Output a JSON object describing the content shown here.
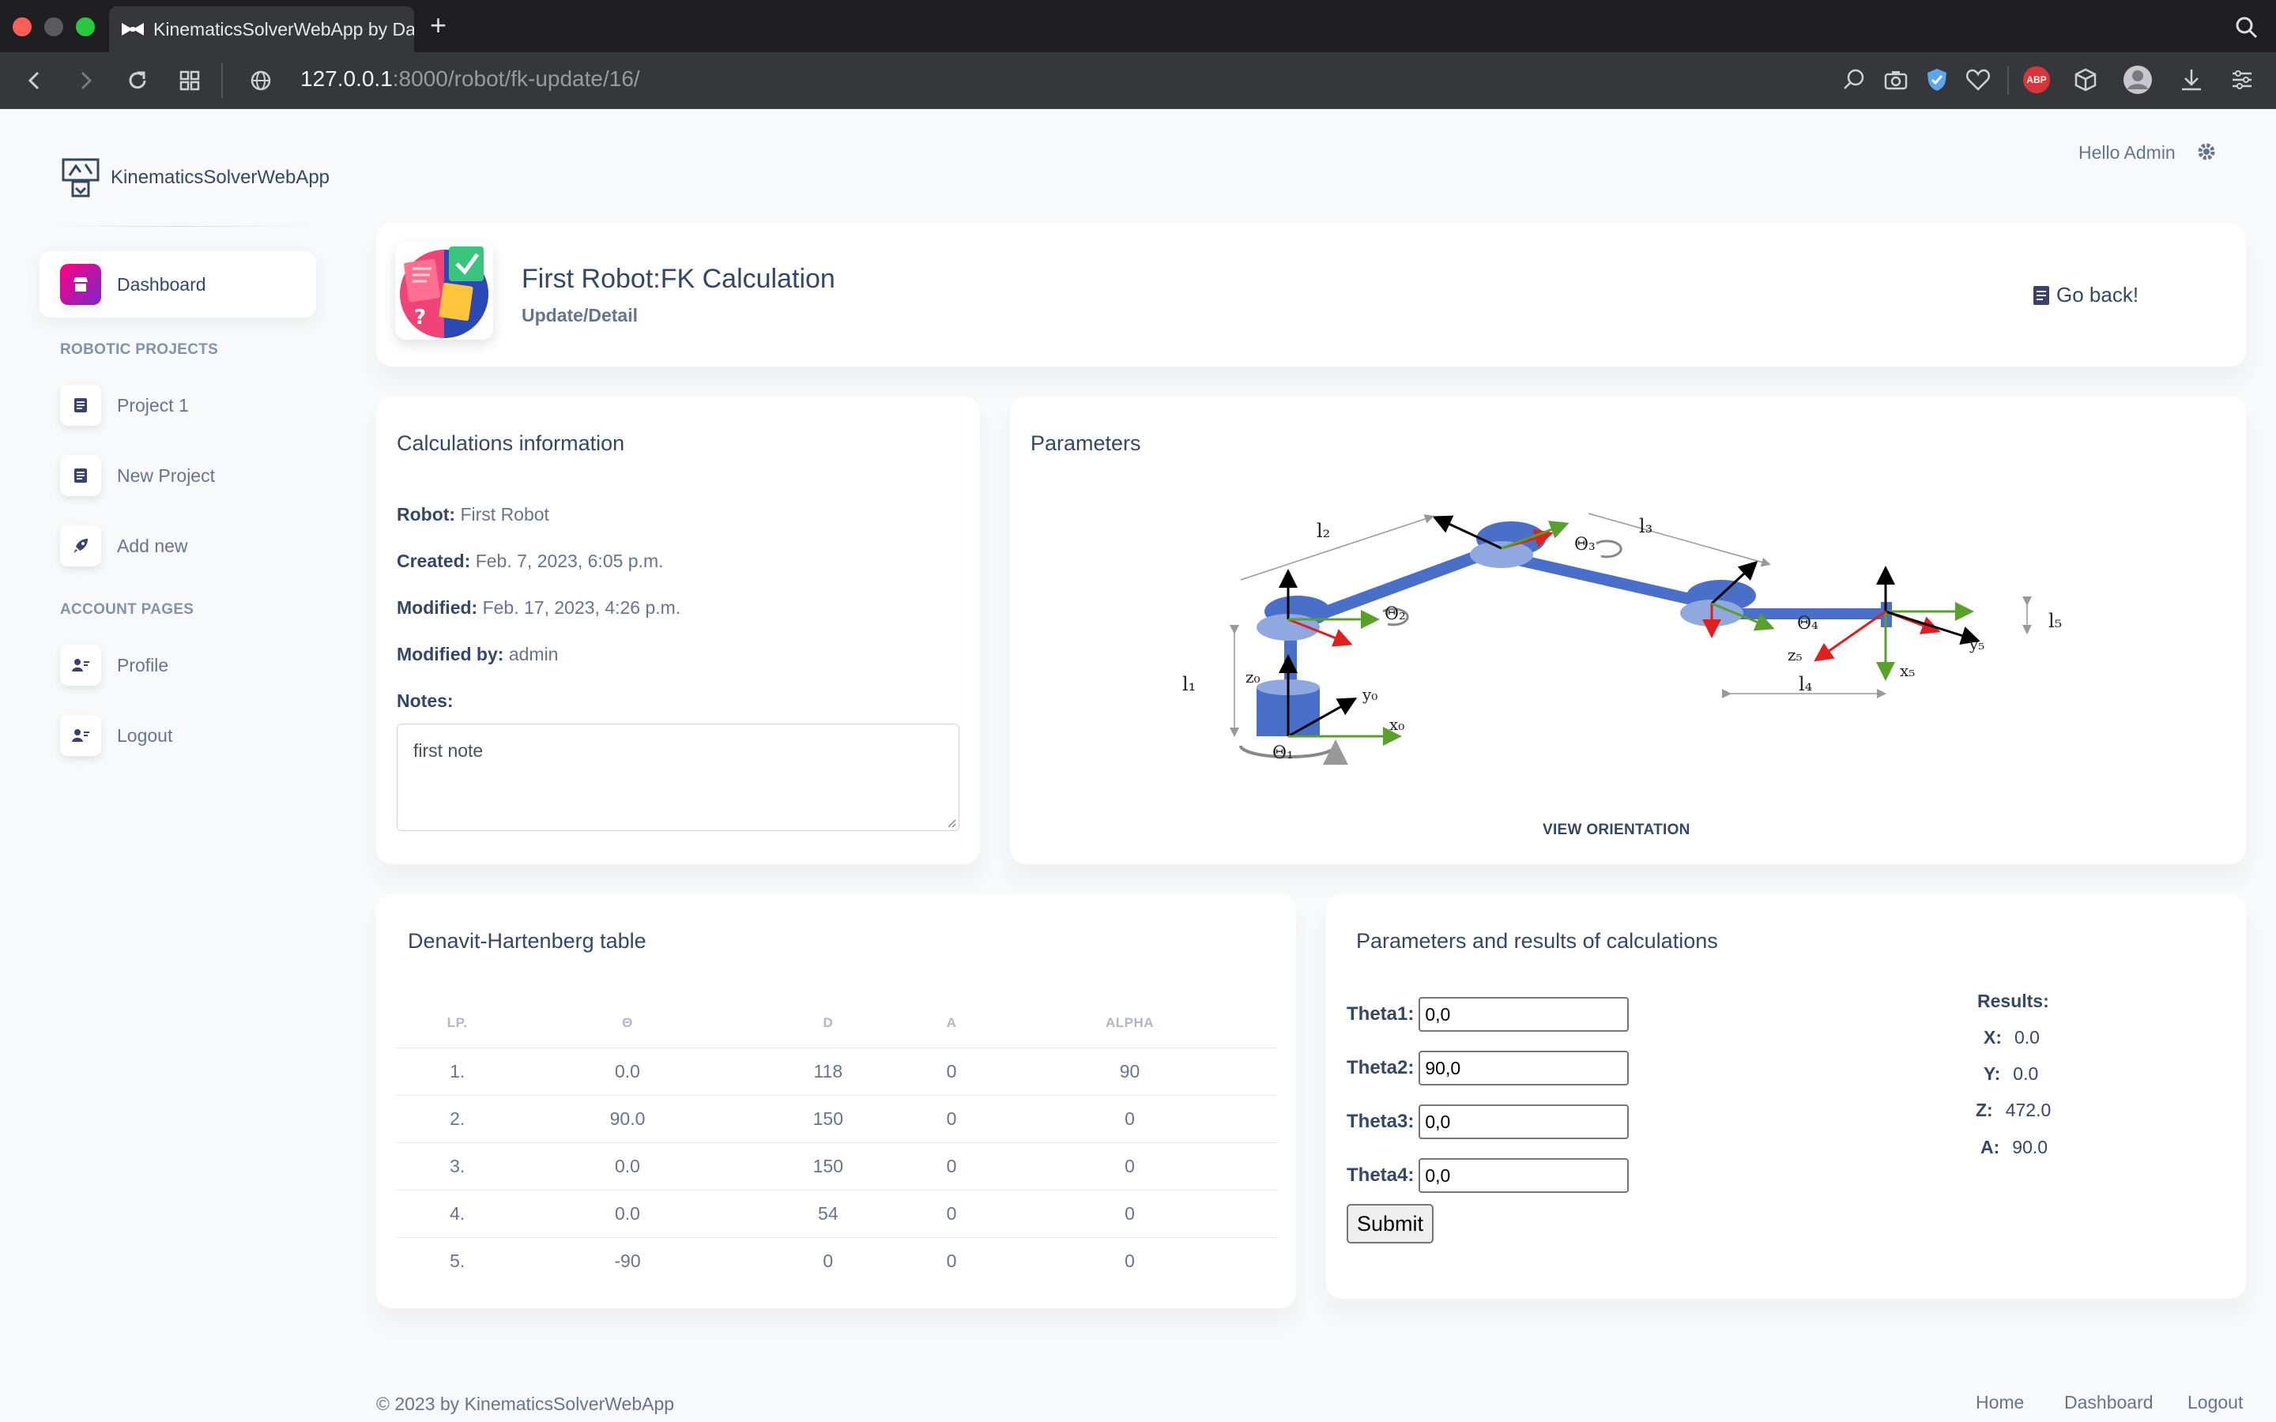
{
  "browser": {
    "tab_title": "KinematicsSolverWebApp by Da",
    "url_host": "127.0.0.1",
    "url_path": ":8000/robot/fk-update/16/",
    "colors": {
      "titlebar": "#1e1e21",
      "toolbar": "#36373b",
      "close": "#fe5f57",
      "minimize": "#febc2e",
      "maximize": "#28c840"
    },
    "icons": [
      "back-icon",
      "forward-icon",
      "reload-icon",
      "tabs-grid-icon",
      "globe-icon",
      "search-icon",
      "camera-icon",
      "shield-icon",
      "heart-icon",
      "adblock-icon",
      "box-icon",
      "profile-icon",
      "download-icon",
      "menu-icon"
    ],
    "adblock_label": "ABP"
  },
  "app": {
    "brand": "KinematicsSolverWebApp",
    "greeting": "Hello Admin",
    "accent": "#cb0c9f"
  },
  "sidebar": {
    "dashboard": "Dashboard",
    "section_projects": "ROBOTIC PROJECTS",
    "project1": "Project 1",
    "new_project": "New Project",
    "add_new": "Add new",
    "section_account": "ACCOUNT PAGES",
    "profile": "Profile",
    "logout": "Logout"
  },
  "header": {
    "title": "First Robot:FK Calculation",
    "subtitle": "Update/Detail",
    "go_back": "Go back!"
  },
  "calc_info": {
    "title": "Calculations information",
    "robot_label": "Robot:",
    "robot_value": "First Robot",
    "created_label": "Created:",
    "created_value": "Feb. 7, 2023, 6:05 p.m.",
    "modified_label": "Modified:",
    "modified_value": "Feb. 17, 2023, 4:26 p.m.",
    "modified_by_label": "Modified by:",
    "modified_by_value": "admin",
    "notes_label": "Notes:",
    "notes_value": "first note"
  },
  "parameters": {
    "title": "Parameters",
    "view_orientation": "VIEW ORIENTATION",
    "diagram_labels": {
      "l1": "l₁",
      "l2": "l₂",
      "l3": "l₃",
      "l4": "l₄",
      "l5": "l₅",
      "theta1": "Θ₁",
      "theta2": "Θ₂",
      "theta3": "Θ₃",
      "theta4": "Θ₄",
      "z0": "z₀",
      "y0": "y₀",
      "x0": "x₀",
      "z5": "z₅",
      "y5": "y₅",
      "x5": "x₅"
    }
  },
  "dh_table": {
    "title": "Denavit-Hartenberg table",
    "headers": [
      "LP.",
      "Θ",
      "D",
      "A",
      "ALPHA"
    ],
    "rows": [
      [
        "1.",
        "0.0",
        "118",
        "0",
        "90"
      ],
      [
        "2.",
        "90.0",
        "150",
        "0",
        "0"
      ],
      [
        "3.",
        "0.0",
        "150",
        "0",
        "0"
      ],
      [
        "4.",
        "0.0",
        "54",
        "0",
        "0"
      ],
      [
        "5.",
        "-90",
        "0",
        "0",
        "0"
      ]
    ]
  },
  "results": {
    "title": "Parameters and results of calculations",
    "theta1_label": "Theta1:",
    "theta1_value": "0,0",
    "theta2_label": "Theta2:",
    "theta2_value": "90,0",
    "theta3_label": "Theta3:",
    "theta3_value": "0,0",
    "theta4_label": "Theta4:",
    "theta4_value": "0,0",
    "submit": "Submit",
    "results_label": "Results:",
    "x_label": "X:",
    "x_value": "0.0",
    "y_label": "Y:",
    "y_value": "0.0",
    "z_label": "Z:",
    "z_value": "472.0",
    "a_label": "A:",
    "a_value": "90.0"
  },
  "footer": {
    "copyright": "© 2023 by KinematicsSolverWebApp",
    "home": "Home",
    "dashboard": "Dashboard",
    "logout": "Logout"
  }
}
